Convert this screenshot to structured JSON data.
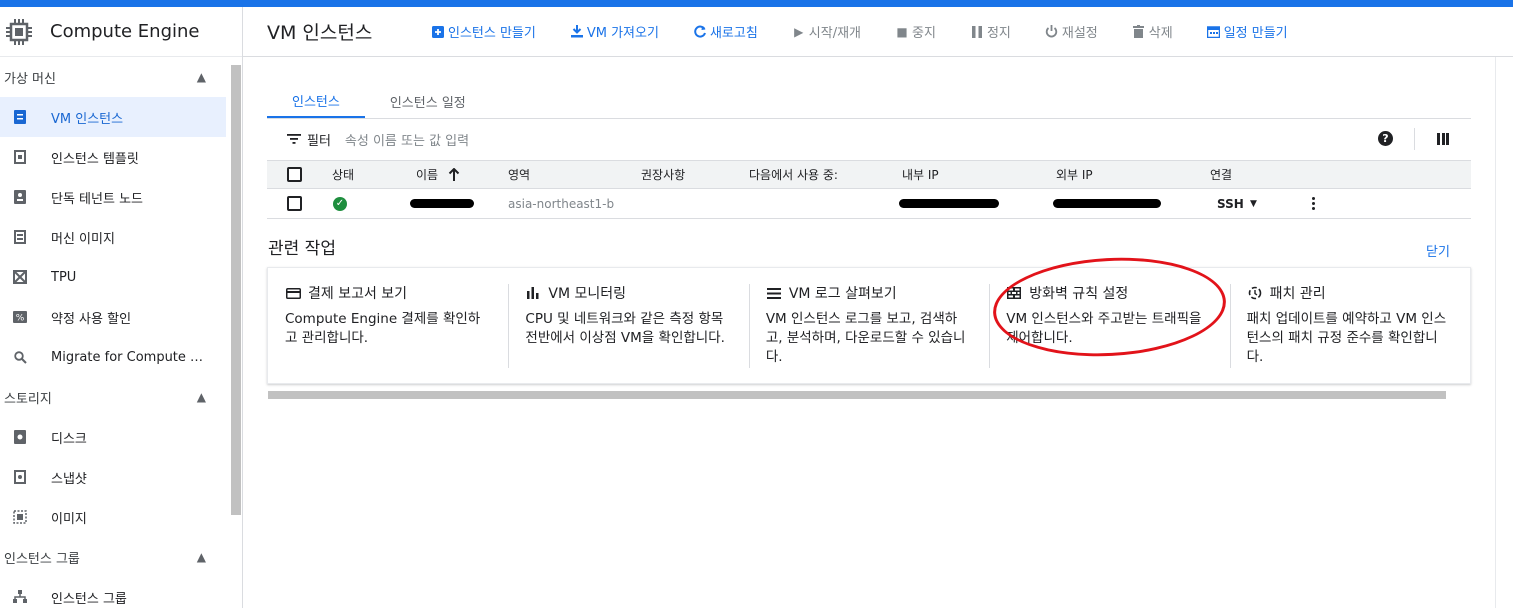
{
  "app": {
    "title": "Compute Engine"
  },
  "sidebar": {
    "sections": [
      {
        "label": "가상 머신",
        "items": [
          {
            "label": "VM 인스턴스",
            "icon": "vm-instance-icon",
            "active": true
          },
          {
            "label": "인스턴스 템플릿",
            "icon": "template-icon"
          },
          {
            "label": "단독 테넌트 노드",
            "icon": "sole-tenant-icon"
          },
          {
            "label": "머신 이미지",
            "icon": "machine-image-icon"
          },
          {
            "label": "TPU",
            "icon": "tpu-icon"
          },
          {
            "label": "약정 사용 할인",
            "icon": "percent-icon"
          },
          {
            "label": "Migrate for Compute Engi...",
            "icon": "search-icon"
          }
        ]
      },
      {
        "label": "스토리지",
        "items": [
          {
            "label": "디스크",
            "icon": "disk-icon"
          },
          {
            "label": "스냅샷",
            "icon": "snapshot-icon"
          },
          {
            "label": "이미지",
            "icon": "image-icon"
          }
        ]
      },
      {
        "label": "인스턴스 그룹",
        "items": [
          {
            "label": "인스턴스 그룹",
            "icon": "instance-group-icon"
          }
        ]
      }
    ]
  },
  "header": {
    "title": "VM 인스턴스",
    "actions": {
      "create": "인스턴스 만들기",
      "import": "VM 가져오기",
      "refresh": "새로고침",
      "start": "시작/재개",
      "stop": "중지",
      "suspend": "정지",
      "reset": "재설정",
      "delete": "삭제",
      "schedule": "일정 만들기"
    }
  },
  "tabs": {
    "instances": "인스턴스",
    "schedule": "인스턴스 일정"
  },
  "filter": {
    "label": "필터",
    "placeholder": "속성 이름 또는 값 입력"
  },
  "table": {
    "headers": {
      "status": "상태",
      "name": "이름",
      "zone": "영역",
      "recommendation": "권장사항",
      "in_use_by": "다음에서 사용 중:",
      "internal_ip": "내부 IP",
      "external_ip": "외부 IP",
      "connect": "연결"
    },
    "rows": [
      {
        "status": "running",
        "zone": "asia-northeast1-b",
        "connect": "SSH"
      }
    ]
  },
  "related": {
    "title": "관련 작업",
    "close": "닫기",
    "cards": [
      {
        "title": "결제 보고서 보기",
        "desc": "Compute Engine 결제를 확인하고 관리합니다.",
        "icon": "billing-icon"
      },
      {
        "title": "VM 모니터링",
        "desc": "CPU 및 네트워크와 같은 측정 항목 전반에서 이상점 VM을 확인합니다.",
        "icon": "bar-chart-icon"
      },
      {
        "title": "VM 로그 살펴보기",
        "desc": "VM 인스턴스 로그를 보고, 검색하고, 분석하며, 다운로드할 수 있습니다.",
        "icon": "logs-icon"
      },
      {
        "title": "방화벽 규칙 설정",
        "desc": "VM 인스턴스와 주고받는 트래픽을 제어합니다.",
        "icon": "firewall-icon"
      },
      {
        "title": "패치 관리",
        "desc": "패치 업데이트를 예약하고 VM 인스턴스의 패치 규정 준수를 확인합니다.",
        "icon": "patch-icon"
      }
    ]
  },
  "colors": {
    "accent": "#1a73e8",
    "annotation": "#e2131a",
    "status_ok": "#1e8e3e"
  }
}
